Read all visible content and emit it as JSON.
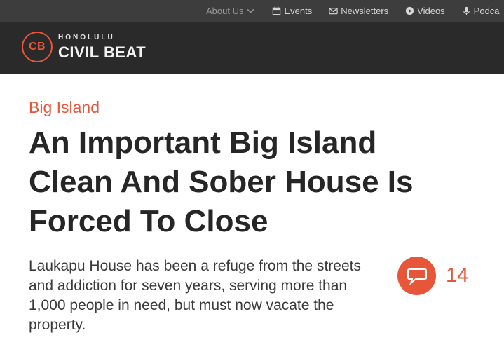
{
  "topnav": {
    "items": [
      {
        "label": "About Us",
        "icon": "chevron-down-icon"
      },
      {
        "label": "Events",
        "icon": "calendar-icon"
      },
      {
        "label": "Newsletters",
        "icon": "envelope-icon"
      },
      {
        "label": "Videos",
        "icon": "play-circle-icon"
      },
      {
        "label": "Podca",
        "icon": "microphone-icon"
      }
    ]
  },
  "logo": {
    "badge": "CB",
    "small_text": "HONOLULU",
    "big_text": "CIVIL BEAT"
  },
  "article": {
    "category": "Big Island",
    "headline": "An Important Big Island Clean And Sober House Is Forced To Close",
    "dek": "Laukapu House has been a refuge from the streets and addiction for seven years, serving more than 1,000 people in need, but must now vacate the property.",
    "comment_count": "14"
  },
  "colors": {
    "accent": "#e8563a",
    "topbar": "#3d3d3d",
    "masthead": "#2a2a2a",
    "headline": "#262626"
  }
}
